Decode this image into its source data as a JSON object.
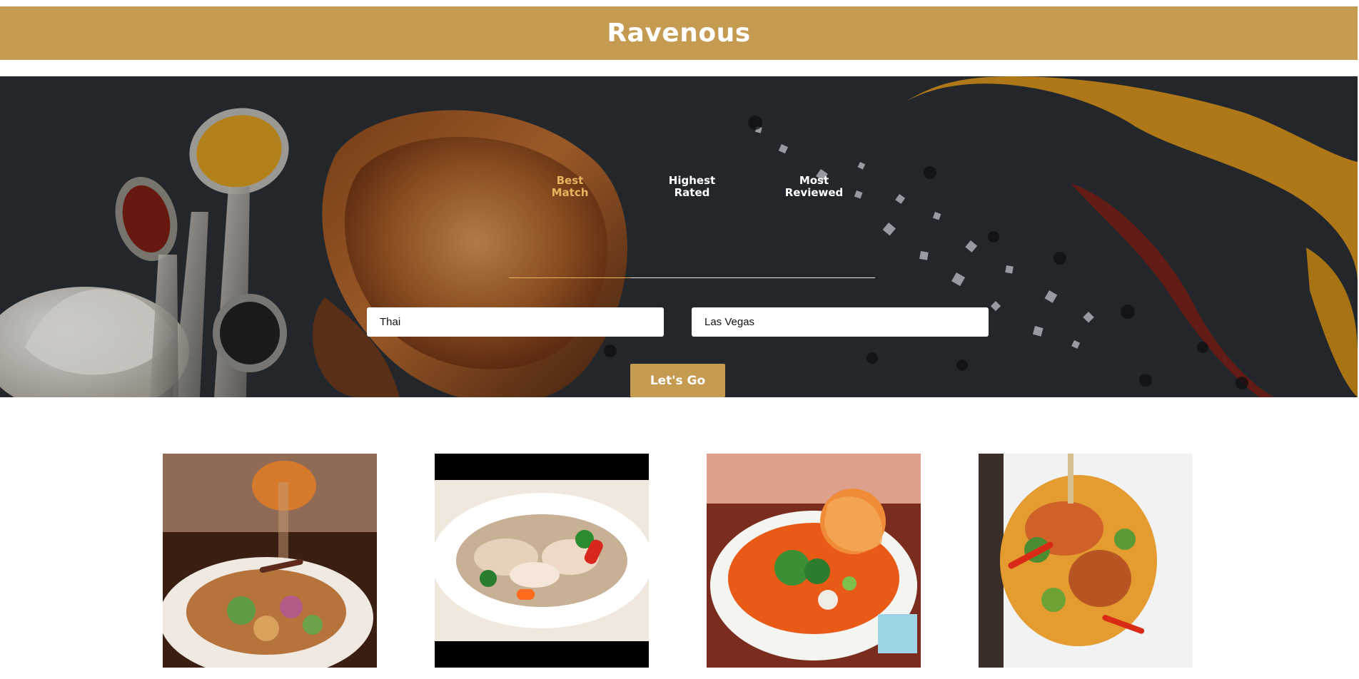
{
  "brand": {
    "title": "Ravenous",
    "color": "#c59a51"
  },
  "search": {
    "tabs": [
      {
        "label": "Best\nMatch",
        "active": true
      },
      {
        "label": "Highest\nRated",
        "active": false
      },
      {
        "label": "Most\nReviewed",
        "active": false
      }
    ],
    "term": {
      "value": "Thai"
    },
    "location": {
      "value": "Las Vegas"
    },
    "submit_label": "Let's Go",
    "active_tab_color": "#e7b35f"
  },
  "results": [
    {
      "photo": "thai-salad-photo"
    },
    {
      "photo": "stir-fry-chicken-photo"
    },
    {
      "photo": "curry-noodle-soup-photo"
    },
    {
      "photo": "spicy-crawfish-photo"
    }
  ]
}
